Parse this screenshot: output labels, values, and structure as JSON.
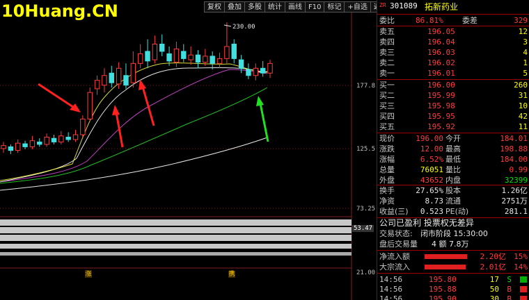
{
  "watermark": "10Huang.CN",
  "toolbar": [
    "复权",
    "叠加",
    "多股",
    "统计",
    "画线",
    "F10",
    "标记",
    "+自选",
    "返回"
  ],
  "chart": {
    "axis_labels": [
      "177.8",
      "125.5",
      "73.25",
      "53.47",
      "21.00"
    ],
    "high_marker": "230.00",
    "tags": [
      "涨",
      "携"
    ],
    "candles": [
      {
        "o": 125.5,
        "c": 128.0,
        "h": 131.0,
        "l": 122.0
      },
      {
        "o": 127.0,
        "c": 124.0,
        "h": 129.0,
        "l": 121.0
      },
      {
        "o": 124.0,
        "c": 130.0,
        "h": 133.0,
        "l": 122.0
      },
      {
        "o": 129.5,
        "c": 127.0,
        "h": 132.0,
        "l": 125.0
      },
      {
        "o": 127.0,
        "c": 132.0,
        "h": 136.0,
        "l": 125.0
      },
      {
        "o": 131.0,
        "c": 129.0,
        "h": 134.0,
        "l": 127.0
      },
      {
        "o": 129.0,
        "c": 135.0,
        "h": 138.0,
        "l": 127.0
      },
      {
        "o": 134.0,
        "c": 131.0,
        "h": 137.0,
        "l": 129.0
      },
      {
        "o": 131.0,
        "c": 136.0,
        "h": 140.0,
        "l": 129.0
      },
      {
        "o": 135.0,
        "c": 133.0,
        "h": 139.0,
        "l": 131.0
      },
      {
        "o": 133.0,
        "c": 137.0,
        "h": 141.0,
        "l": 131.0
      },
      {
        "o": 137.0,
        "c": 150.0,
        "h": 153.0,
        "l": 135.0
      },
      {
        "o": 150.0,
        "c": 172.0,
        "h": 176.0,
        "l": 148.0
      },
      {
        "o": 175.0,
        "c": 182.0,
        "h": 186.0,
        "l": 170.0
      },
      {
        "o": 178.0,
        "c": 186.0,
        "h": 192.0,
        "l": 172.0
      },
      {
        "o": 188.0,
        "c": 180.0,
        "h": 194.0,
        "l": 176.0
      },
      {
        "o": 179.0,
        "c": 192.0,
        "h": 197.0,
        "l": 175.0
      },
      {
        "o": 186.0,
        "c": 178.0,
        "h": 196.0,
        "l": 175.0
      },
      {
        "o": 180.0,
        "c": 196.0,
        "h": 206.0,
        "l": 176.0
      },
      {
        "o": 196.0,
        "c": 204.0,
        "h": 212.0,
        "l": 192.0
      },
      {
        "o": 206.0,
        "c": 198.0,
        "h": 216.0,
        "l": 192.0
      },
      {
        "o": 199.0,
        "c": 212.0,
        "h": 219.0,
        "l": 196.0
      },
      {
        "o": 212.0,
        "c": 206.0,
        "h": 220.0,
        "l": 202.0
      },
      {
        "o": 204.0,
        "c": 198.0,
        "h": 210.0,
        "l": 194.0
      },
      {
        "o": 197.0,
        "c": 208.0,
        "h": 214.0,
        "l": 193.0
      },
      {
        "o": 206.0,
        "c": 200.0,
        "h": 212.0,
        "l": 197.0
      },
      {
        "o": 199.0,
        "c": 203.0,
        "h": 210.0,
        "l": 195.0
      },
      {
        "o": 203.0,
        "c": 197.0,
        "h": 207.0,
        "l": 192.0
      },
      {
        "o": 197.0,
        "c": 202.0,
        "h": 208.0,
        "l": 194.0
      },
      {
        "o": 202.0,
        "c": 196.0,
        "h": 206.0,
        "l": 191.0
      },
      {
        "o": 196.0,
        "c": 200.0,
        "h": 205.0,
        "l": 192.0
      },
      {
        "o": 200.0,
        "c": 210.0,
        "h": 230.0,
        "l": 196.0
      },
      {
        "o": 212.0,
        "c": 200.0,
        "h": 216.0,
        "l": 196.0
      },
      {
        "o": 199.0,
        "c": 192.0,
        "h": 203.0,
        "l": 188.0
      },
      {
        "o": 191.0,
        "c": 186.0,
        "h": 196.0,
        "l": 183.0
      },
      {
        "o": 186.0,
        "c": 192.0,
        "h": 196.0,
        "l": 182.0
      },
      {
        "o": 192.0,
        "c": 188.0,
        "h": 198.0,
        "l": 185.0
      },
      {
        "o": 188.0,
        "c": 196.0,
        "h": 199.0,
        "l": 184.0
      }
    ]
  },
  "panel": {
    "flag": "ZR",
    "code": "301089",
    "name": "拓新药业",
    "weibi_label": "委比",
    "weibi_value": "86.81%",
    "weicha_label": "委差",
    "weicha_value": "329",
    "asks": [
      {
        "label": "卖五",
        "price": "196.05",
        "vol": "12"
      },
      {
        "label": "卖四",
        "price": "196.04",
        "vol": "3"
      },
      {
        "label": "卖三",
        "price": "196.03",
        "vol": "4"
      },
      {
        "label": "卖二",
        "price": "196.02",
        "vol": "1"
      },
      {
        "label": "卖一",
        "price": "196.01",
        "vol": "5"
      }
    ],
    "bids": [
      {
        "label": "买一",
        "price": "196.00",
        "vol": "260"
      },
      {
        "label": "买二",
        "price": "195.99",
        "vol": "31"
      },
      {
        "label": "买三",
        "price": "195.98",
        "vol": "10"
      },
      {
        "label": "买四",
        "price": "195.95",
        "vol": "42"
      },
      {
        "label": "买五",
        "price": "195.92",
        "vol": "11"
      }
    ],
    "quote": [
      {
        "l1": "现价",
        "v1": "196.00",
        "l2": "今开",
        "v2": "184.01"
      },
      {
        "l1": "涨跌",
        "v1": "12.00",
        "l2": "最高",
        "v2": "198.88"
      },
      {
        "l1": "涨幅",
        "v1": "6.52%",
        "l2": "最低",
        "v2": "184.00"
      },
      {
        "l1": "总量",
        "v1": "76051",
        "l2": "量比",
        "v2": "0.99"
      },
      {
        "l1": "外盘",
        "v1": "43652",
        "l2": "内盘",
        "v2": "32399"
      }
    ],
    "stats": [
      {
        "l1": "换手",
        "v1": "27.65%",
        "l2": "股本",
        "v2": "1.26亿"
      },
      {
        "l1": "净资",
        "v1": "8.73",
        "l2": "流通",
        "v2": "2751万"
      },
      {
        "l1": "收益(三)",
        "v1": "0.523",
        "l2": "PE(动)",
        "v2": "281.1"
      }
    ],
    "info1": "公司已盈利 投票权无差异",
    "info2_label": "交易状态:",
    "info2_value": "闭市阶段 15:30:00",
    "info3_label": "盘后交易量",
    "info3_value": "4 额 7.8万",
    "flows": [
      {
        "label": "净流入额",
        "value": "2.20亿",
        "pct": "15%",
        "fill": 0.72
      },
      {
        "label": "大宗流入",
        "value": "2.01亿",
        "pct": "14%",
        "fill": 0.7
      }
    ],
    "ticks": [
      {
        "time": "14:56",
        "price": "195.80",
        "vol": "17",
        "side": "S"
      },
      {
        "time": "14:56",
        "price": "195.88",
        "vol": "50",
        "side": "B"
      },
      {
        "time": "14:56",
        "price": "195.90",
        "vol": "30",
        "side": "B"
      }
    ]
  }
}
